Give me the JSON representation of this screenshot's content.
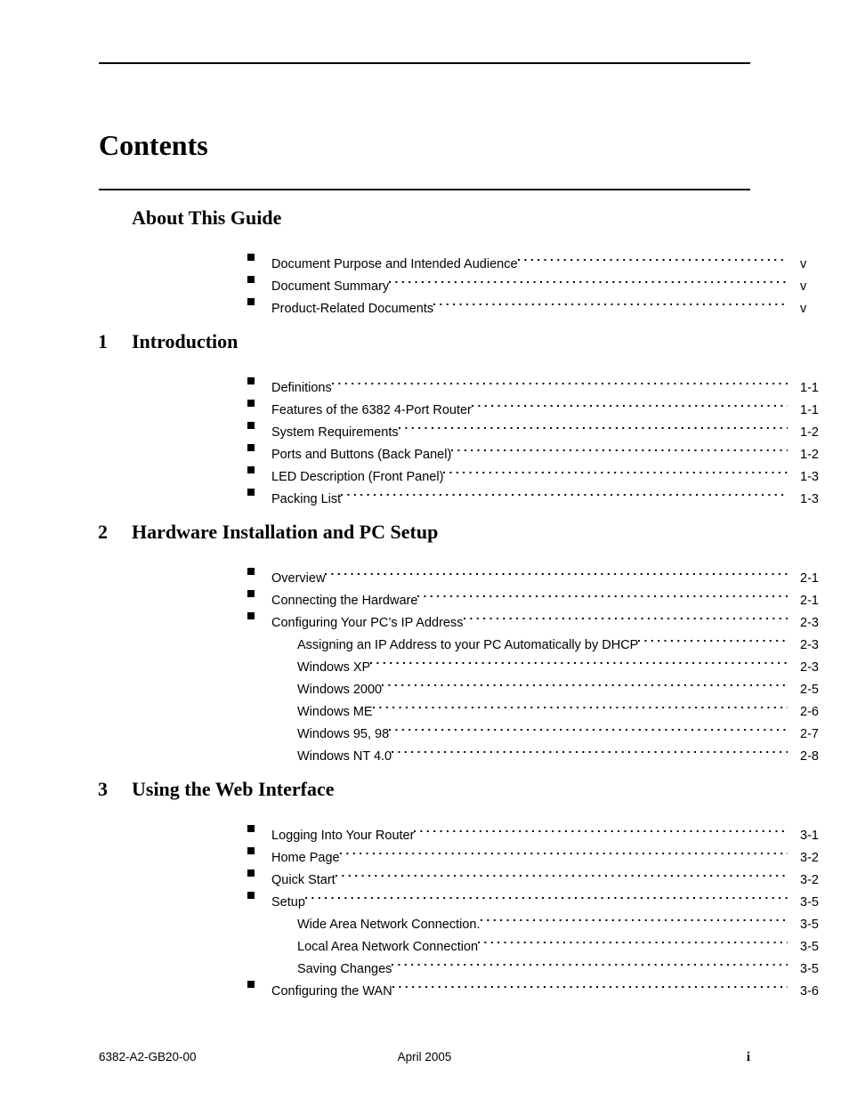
{
  "document": {
    "page_title": "Contents"
  },
  "sections": [
    {
      "number": "",
      "title": "About This Guide",
      "entries": [
        {
          "level": "main",
          "label": "Document Purpose and Intended Audience",
          "page": "v"
        },
        {
          "level": "main",
          "label": "Document Summary",
          "page": "v"
        },
        {
          "level": "main",
          "label": "Product-Related Documents",
          "page": "v"
        }
      ]
    },
    {
      "number": "1",
      "title": "Introduction",
      "entries": [
        {
          "level": "main",
          "label": "Definitions",
          "page": "1-1"
        },
        {
          "level": "main",
          "label": "Features of the 6382 4-Port Router",
          "page": "1-1"
        },
        {
          "level": "main",
          "label": "System Requirements",
          "page": "1-2"
        },
        {
          "level": "main",
          "label": "Ports and Buttons (Back Panel)",
          "page": "1-2"
        },
        {
          "level": "main",
          "label": "LED Description (Front Panel)",
          "page": "1-3"
        },
        {
          "level": "main",
          "label": "Packing List",
          "page": "1-3"
        }
      ]
    },
    {
      "number": "2",
      "title": "Hardware Installation and PC Setup",
      "entries": [
        {
          "level": "main",
          "label": "Overview",
          "page": "2-1"
        },
        {
          "level": "main",
          "label": "Connecting the Hardware",
          "page": "2-1"
        },
        {
          "level": "main",
          "label": "Configuring Your PC’s IP Address",
          "page": "2-3"
        },
        {
          "level": "sub",
          "label": "Assigning an IP Address to your PC Automatically by DHCP",
          "page": "2-3"
        },
        {
          "level": "sub",
          "label": "Windows XP",
          "page": "2-3"
        },
        {
          "level": "sub",
          "label": "Windows 2000",
          "page": "2-5"
        },
        {
          "level": "sub",
          "label": "Windows ME",
          "page": "2-6"
        },
        {
          "level": "sub",
          "label": "Windows 95, 98",
          "page": "2-7"
        },
        {
          "level": "sub",
          "label": "Windows NT 4.0",
          "page": "2-8"
        }
      ]
    },
    {
      "number": "3",
      "title": "Using the Web Interface",
      "entries": [
        {
          "level": "main",
          "label": "Logging Into Your Router",
          "page": "3-1"
        },
        {
          "level": "main",
          "label": "Home Page",
          "page": "3-2"
        },
        {
          "level": "main",
          "label": "Quick Start",
          "page": "3-2"
        },
        {
          "level": "main",
          "label": "Setup",
          "page": "3-5"
        },
        {
          "level": "sub",
          "label": "Wide Area Network Connection.",
          "page": "3-5"
        },
        {
          "level": "sub",
          "label": "Local Area Network Connection",
          "page": "3-5"
        },
        {
          "level": "sub",
          "label": "Saving Changes",
          "page": "3-5"
        },
        {
          "level": "main",
          "label": "Configuring the WAN",
          "page": "3-6"
        }
      ]
    }
  ],
  "footer": {
    "document_number": "6382-A2-GB20-00",
    "date": "April 2005",
    "page_number": "i"
  }
}
